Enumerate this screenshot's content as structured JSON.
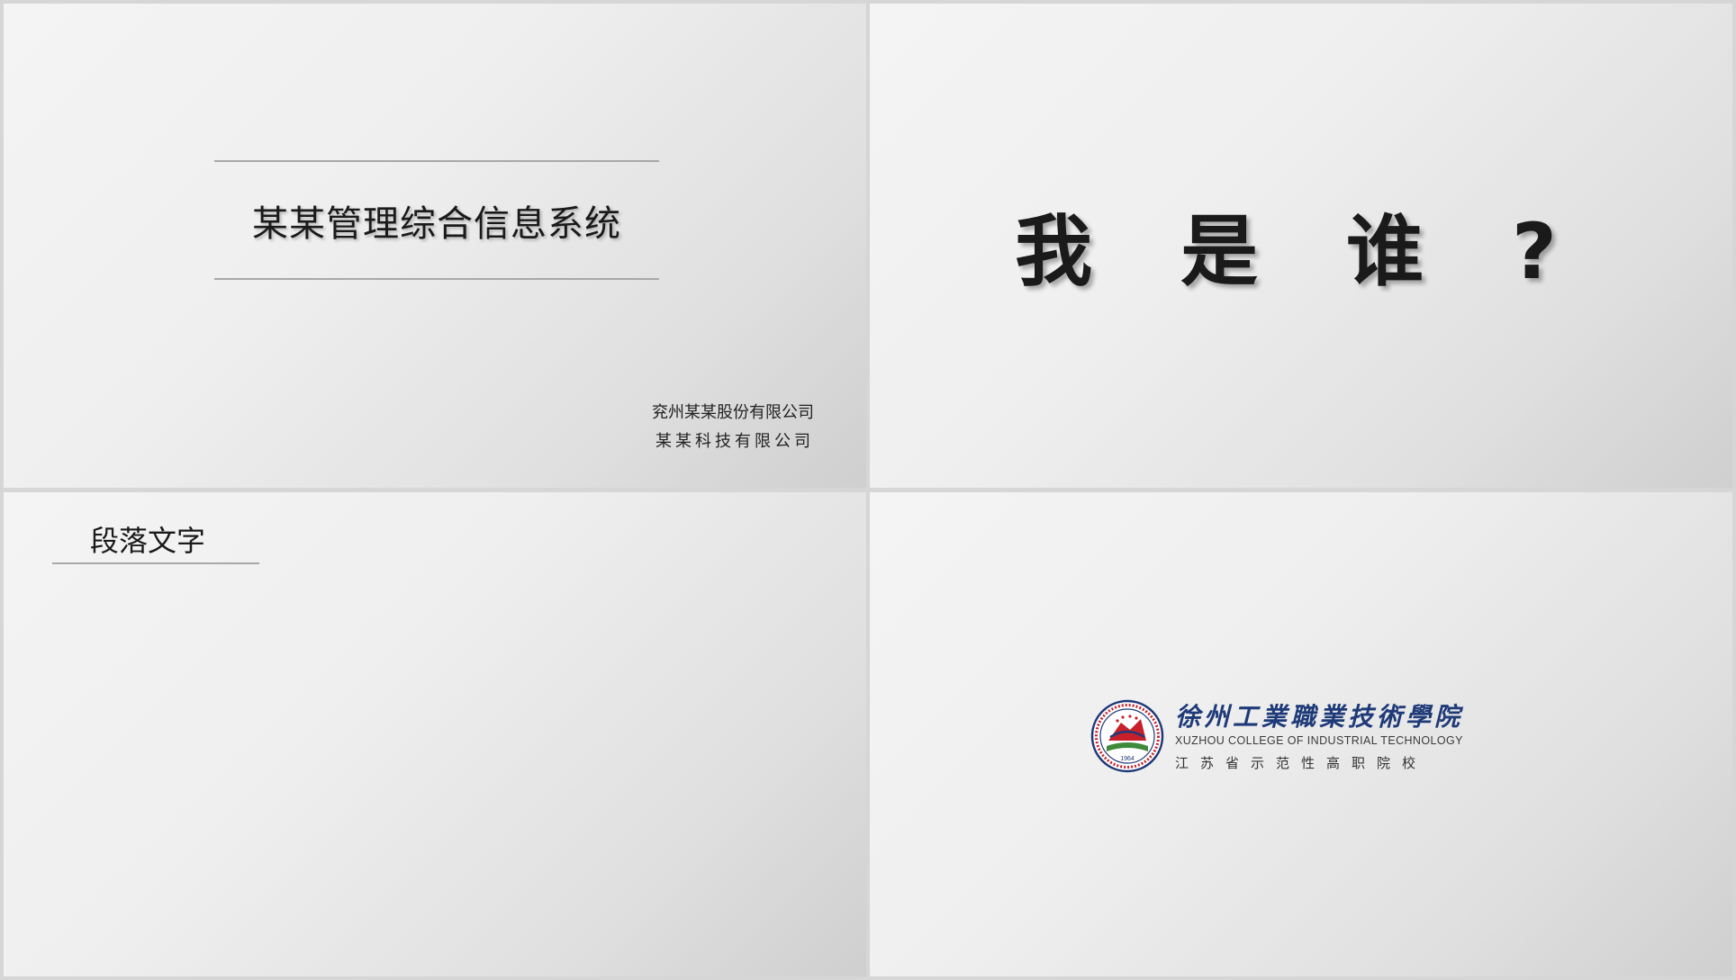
{
  "slides": {
    "title_slide": {
      "title": "某某管理综合信息系统",
      "company_line_1": "兖州某某股份有限公司",
      "company_line_2": "某某科技有限公司"
    },
    "question_slide": {
      "text": "我 是 谁 ?"
    },
    "paragraph_slide": {
      "heading": "段落文字"
    },
    "logo_slide": {
      "cn_name": "徐州工業職業技術學院",
      "en_name": "XUZHOU COLLEGE OF INDUSTRIAL TECHNOLOGY",
      "tagline": "江苏省示范性高职院校",
      "emblem_year": "1964",
      "emblem_icon": "college-emblem",
      "colors": {
        "brand_blue": "#1e3a78",
        "emblem_red": "#c8202a",
        "emblem_green": "#3f8a3a"
      }
    }
  }
}
